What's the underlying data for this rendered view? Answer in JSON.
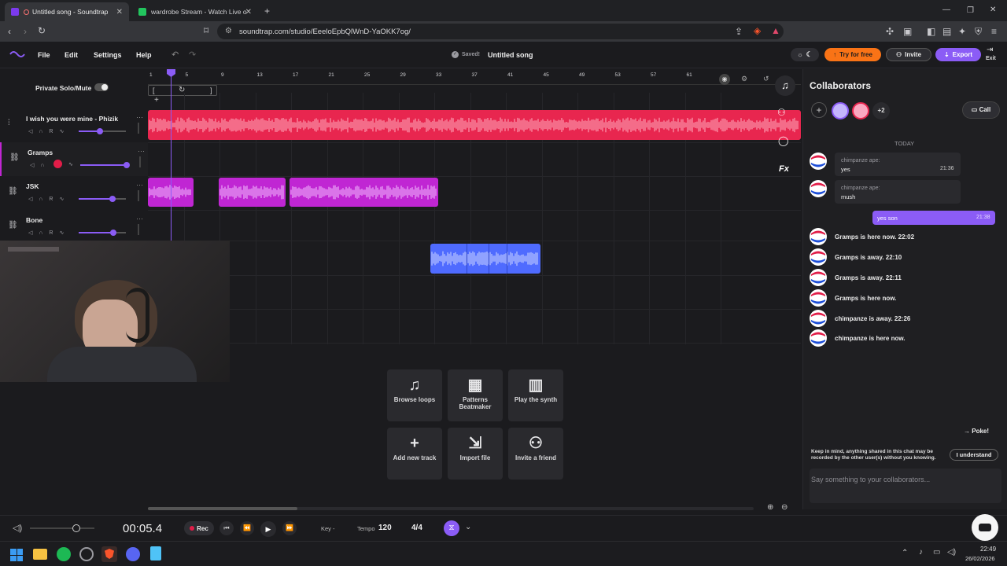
{
  "browser": {
    "tabs": [
      {
        "title": "Untitled song - Soundtrap",
        "active": true
      },
      {
        "title": "wardrobe Stream - Watch Live o",
        "active": false
      }
    ],
    "url": "soundtrap.com/studio/EeeloEpbQlWnD-YaOKK7og/"
  },
  "app": {
    "menu": [
      "File",
      "Edit",
      "Settings",
      "Help"
    ],
    "saved_label": "Saved!",
    "song_title": "Untitled song",
    "try_free": "Try for free",
    "invite": "Invite",
    "export": "Export",
    "exit": "Exit",
    "private_solo": "Private Solo/Mute",
    "add_track_plus": "+"
  },
  "tracks": [
    {
      "name": "I wish you were mine - Phizik",
      "volume": 0.6
    },
    {
      "name": "Gramps",
      "volume": 0.9
    },
    {
      "name": "JSK",
      "volume": 0.75
    },
    {
      "name": "Bone",
      "volume": 0.75
    }
  ],
  "track_controls": {
    "rec_letter": "R"
  },
  "ruler": [
    "1",
    "5",
    "9",
    "13",
    "17",
    "21",
    "25",
    "29",
    "33",
    "37",
    "41",
    "45",
    "49",
    "53",
    "57",
    "61"
  ],
  "tiles": [
    {
      "label": "Browse loops",
      "icon": "music-note-icon"
    },
    {
      "label": "Patterns Beatmaker",
      "icon": "grid-icon"
    },
    {
      "label": "Play the synth",
      "icon": "piano-icon"
    },
    {
      "label": "Add new track",
      "icon": "plus-icon"
    },
    {
      "label": "Import file",
      "icon": "import-icon"
    },
    {
      "label": "Invite a friend",
      "icon": "add-friend-icon"
    }
  ],
  "collab": {
    "title": "Collaborators",
    "more_count": "+2",
    "call": "Call",
    "today": "TODAY",
    "messages": [
      {
        "author": "chimpanze ape:",
        "text": "yes",
        "time": "21:36"
      },
      {
        "author": "chimpanze ape:",
        "text": "mush",
        "time": ""
      }
    ],
    "own_message": {
      "text": "yes son",
      "time": "21:38"
    },
    "statuses": [
      "Gramps is here now. 22:02",
      "Gramps is away. 22:10",
      "Gramps is away. 22:11",
      "Gramps is here now.",
      "chimpanze is away. 22:26",
      "chimpanze is here now."
    ],
    "poke": "Poke!",
    "notice": "Keep in mind, anything shared in this chat may be recorded by the other user(s) without you knowing.",
    "understand": "I understand",
    "input_placeholder": "Say something to your collaborators..."
  },
  "transport": {
    "time": "00:05.4",
    "rec": "Rec",
    "key_label": "Key",
    "key_value": "-",
    "tempo_label": "Tempo",
    "tempo_value": "120",
    "signature": "4/4"
  },
  "taskbar": {
    "time": "22:49",
    "date": "26/02/2026"
  },
  "colors": {
    "accent": "#8b5cf6",
    "track1": "#e8264f",
    "track2": "#c026d3",
    "track3": "#4f6bff"
  }
}
